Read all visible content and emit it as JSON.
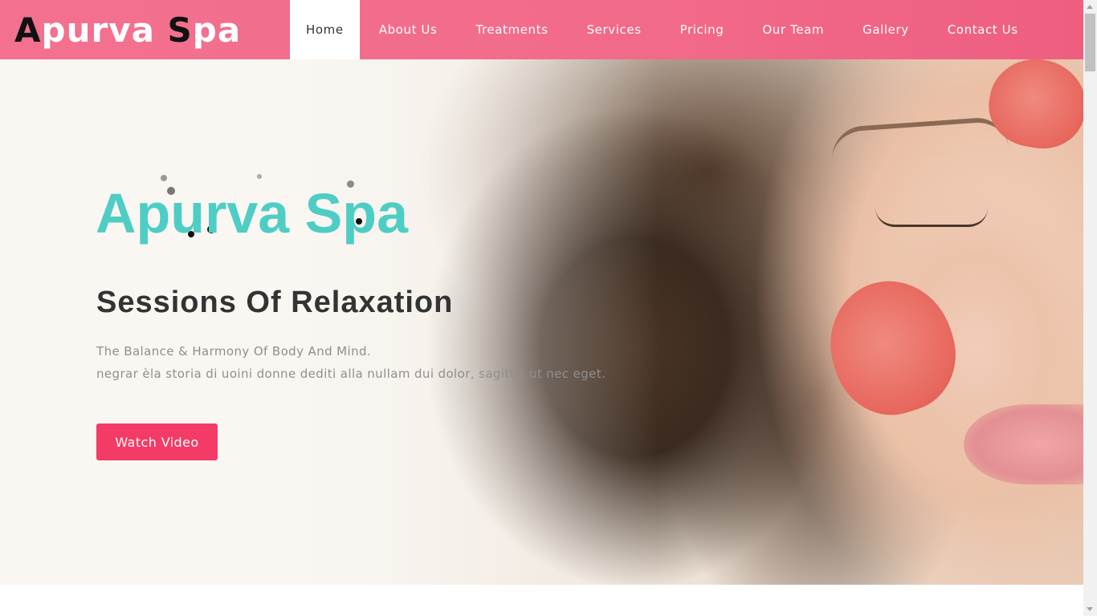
{
  "brand": {
    "logo_first_letter": "A",
    "logo_first_rest": "purva",
    "logo_second_letter": "S",
    "logo_second_rest": "pa",
    "logo_colors": {
      "initials": "#111111",
      "rest": "#ffffff"
    }
  },
  "nav": {
    "items": [
      {
        "label": "Home",
        "active": true
      },
      {
        "label": "About Us",
        "active": false
      },
      {
        "label": "Treatments",
        "active": false
      },
      {
        "label": "Services",
        "active": false
      },
      {
        "label": "Pricing",
        "active": false
      },
      {
        "label": "Our Team",
        "active": false
      },
      {
        "label": "Gallery",
        "active": false
      },
      {
        "label": "Contact Us",
        "active": false
      }
    ]
  },
  "hero": {
    "title": "Apurva Spa",
    "subtitle": "Sessions Of Relaxation",
    "line1": "The Balance & Harmony Of Body And Mind.",
    "line2": "negrar èla storia di uoini donne dediti alla nullam dui dolor, sagittis ut nec eget.",
    "cta_label": "Watch Video"
  },
  "colors": {
    "header_pink": "#f26a8a",
    "title_teal": "#4ecdc4",
    "button_pink": "#f43a66",
    "text_dark": "#333333",
    "text_muted": "#8f8f8f"
  }
}
